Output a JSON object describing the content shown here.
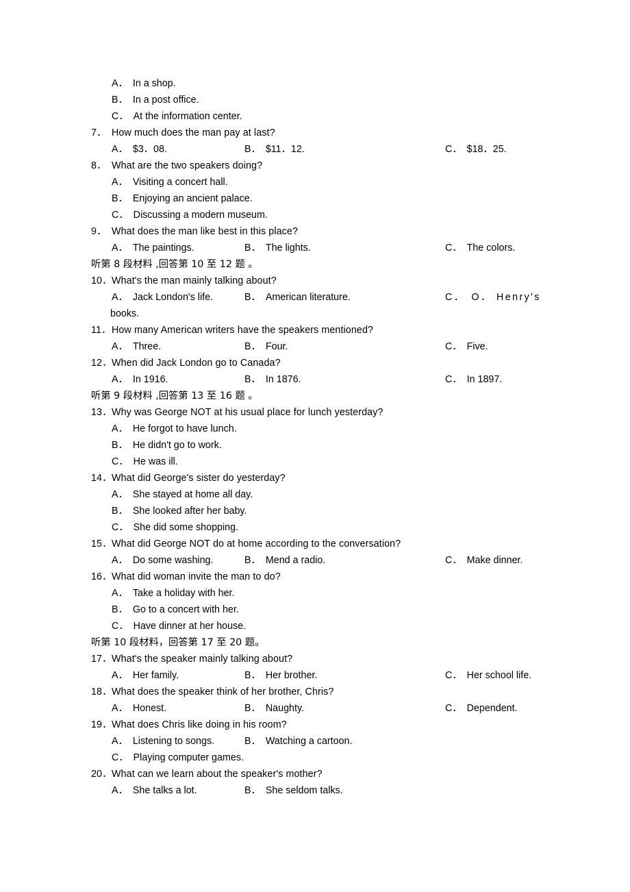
{
  "document": {
    "type": "listening-comprehension-answer-options",
    "background_color": "#ffffff",
    "text_color": "#000000"
  },
  "labels": {
    "a": "A．",
    "b": "B．",
    "c": "C．"
  },
  "q6_options": {
    "a": "In a shop.",
    "b": "In a post office.",
    "c": "At the information center."
  },
  "q7": {
    "num": "7．",
    "stem": "How much does the man pay at last?",
    "a": "$3．08.",
    "b": "$11．12.",
    "c": "$18．25."
  },
  "q8": {
    "num": "8．",
    "stem": "What are the two speakers doing?",
    "a": "Visiting a concert hall.",
    "b": "Enjoying an ancient palace.",
    "c": "Discussing a modern museum."
  },
  "q9": {
    "num": "9．",
    "stem": "What does the man like best in this place?",
    "a": "The paintings.",
    "b": "The lights.",
    "c": "The colors."
  },
  "instruction_8": "听第 8 段材料 ,回答第 10 至 12 题 。",
  "q10": {
    "num": "10．",
    "stem": "What's the man mainly talking about?",
    "a": "Jack London's life.",
    "b": "American literature.",
    "c": "O． Henry's",
    "c_cont": "books."
  },
  "q11": {
    "num": "11．",
    "stem": "How many American writers have the speakers mentioned?",
    "a": "Three.",
    "b": "Four.",
    "c": "Five."
  },
  "q12": {
    "num": "12．",
    "stem": "When did Jack London go to Canada?",
    "a": "In 1916.",
    "b": "In 1876.",
    "c": "In 1897."
  },
  "instruction_9": "听第 9 段材料 ,回答第 13 至 16 题 。",
  "q13": {
    "num": "13．",
    "stem": "Why was George NOT at his usual place for lunch yesterday?",
    "a": "He forgot to have lunch.",
    "b": "He didn't go to work.",
    "c": "He was ill."
  },
  "q14": {
    "num": "14．",
    "stem": "What did George's sister do yesterday?",
    "a": "She stayed at home all day.",
    "b": "She looked after her baby.",
    "c": "She did some shopping."
  },
  "q15": {
    "num": "15．",
    "stem": "What did George NOT do at home according to the conversation?",
    "a": "Do some washing.",
    "b": "Mend a radio.",
    "c": "Make dinner."
  },
  "q16": {
    "num": "16．",
    "stem": "What did woman invite the man to do?",
    "a": "Take a holiday with her.",
    "b": "Go to a concert with her.",
    "c": "Have dinner at her house."
  },
  "instruction_10": "听第 10 段材料，回答第 17 至 20 题。",
  "q17": {
    "num": "17．",
    "stem": "What's the speaker mainly talking about?",
    "a": "Her family.",
    "b": "Her brother.",
    "c": "Her school life."
  },
  "q18": {
    "num": "18．",
    "stem": "What does the speaker think of her brother, Chris?",
    "a": "Honest.",
    "b": "Naughty.",
    "c": "Dependent."
  },
  "q19": {
    "num": "19．",
    "stem": "What does Chris like doing in his room?",
    "a": "Listening to songs.",
    "b": "Watching a cartoon.",
    "c": "Playing computer games."
  },
  "q20": {
    "num": "20．",
    "stem": "What can we learn about the speaker's mother?",
    "a": "She talks a lot.",
    "b": "She seldom talks."
  }
}
